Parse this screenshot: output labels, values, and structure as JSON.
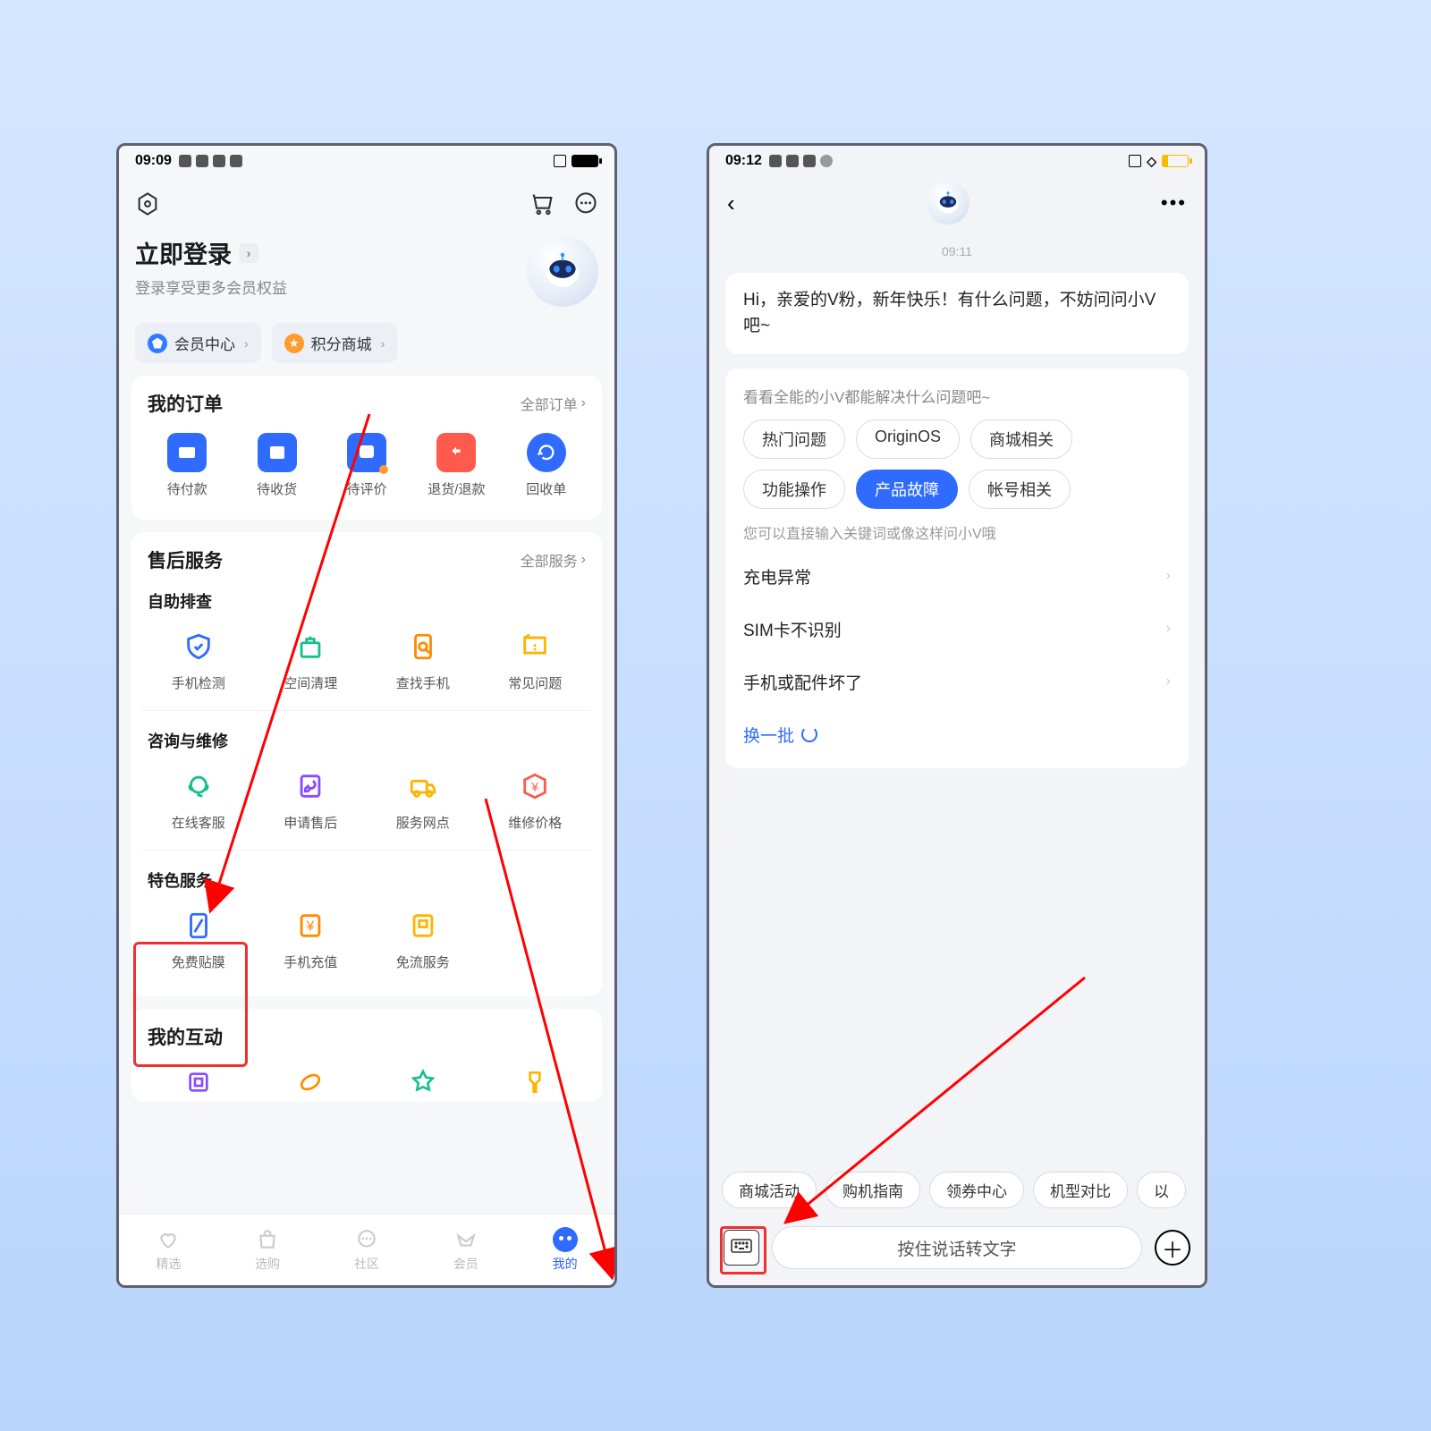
{
  "left": {
    "status": {
      "time": "09:09"
    },
    "login": {
      "title": "立即登录",
      "subtitle": "登录享受更多会员权益"
    },
    "pills": {
      "member": "会员中心",
      "points": "积分商城"
    },
    "orders": {
      "title": "我的订单",
      "more": "全部订单",
      "items": [
        {
          "label": "待付款"
        },
        {
          "label": "待收货"
        },
        {
          "label": "待评价"
        },
        {
          "label": "退货/退款"
        },
        {
          "label": "回收单"
        }
      ]
    },
    "service": {
      "title": "售后服务",
      "more": "全部服务",
      "s1": {
        "head": "自助排查",
        "items": [
          {
            "label": "手机检测"
          },
          {
            "label": "空间清理"
          },
          {
            "label": "查找手机"
          },
          {
            "label": "常见问题"
          }
        ]
      },
      "s2": {
        "head": "咨询与维修",
        "items": [
          {
            "label": "在线客服"
          },
          {
            "label": "申请售后"
          },
          {
            "label": "服务网点"
          },
          {
            "label": "维修价格"
          }
        ]
      },
      "s3": {
        "head": "特色服务",
        "items": [
          {
            "label": "免费贴膜"
          },
          {
            "label": "手机充值"
          },
          {
            "label": "免流服务"
          }
        ]
      }
    },
    "interact": {
      "title": "我的互动"
    },
    "tabs": [
      {
        "label": "精选"
      },
      {
        "label": "选购"
      },
      {
        "label": "社区"
      },
      {
        "label": "会员"
      },
      {
        "label": "我的"
      }
    ]
  },
  "right": {
    "status": {
      "time": "09:12"
    },
    "timestamp": "09:11",
    "greeting": "Hi，亲爱的V粉，新年快乐！有什么问题，不妨问问小V吧~",
    "panel": {
      "title": "看看全能的小V都能解决什么问题吧~",
      "chips": [
        "热门问题",
        "OriginOS",
        "商城相关",
        "功能操作",
        "产品故障",
        "帐号相关"
      ],
      "active_chip": 4,
      "subtitle": "您可以直接输入关键词或像这样问小V哦",
      "issues": [
        "充电异常",
        "SIM卡不识别",
        "手机或配件坏了"
      ],
      "refresh": "换一批"
    },
    "quick": [
      "商城活动",
      "购机指南",
      "领券中心",
      "机型对比",
      "以"
    ],
    "voice_placeholder": "按住说话转文字"
  }
}
